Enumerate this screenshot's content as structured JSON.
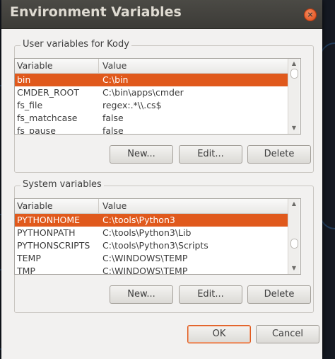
{
  "window": {
    "title": "Environment Variables",
    "close_symbol": "×"
  },
  "user_vars": {
    "group_label": "User variables for Kody",
    "header": {
      "variable": "Variable",
      "value": "Value"
    },
    "rows": [
      {
        "variable": "bin",
        "value": "C:\\bin",
        "selected": true
      },
      {
        "variable": "CMDER_ROOT",
        "value": "C:\\bin\\apps\\cmder",
        "selected": false
      },
      {
        "variable": "fs_file",
        "value": "regex:.*\\\\.cs$",
        "selected": false
      },
      {
        "variable": "fs_matchcase",
        "value": "false",
        "selected": false
      },
      {
        "variable": "fs_pause",
        "value": "false",
        "selected": false
      }
    ],
    "buttons": {
      "new": "New...",
      "edit": "Edit...",
      "delete": "Delete"
    }
  },
  "system_vars": {
    "group_label": "System variables",
    "header": {
      "variable": "Variable",
      "value": "Value"
    },
    "rows": [
      {
        "variable": "PYTHONHOME",
        "value": "C:\\tools\\Python3",
        "selected": true
      },
      {
        "variable": "PYTHONPATH",
        "value": "C:\\tools\\Python3\\Lib",
        "selected": false
      },
      {
        "variable": "PYTHONSCRIPTS",
        "value": "C:\\tools\\Python3\\Scripts",
        "selected": false
      },
      {
        "variable": "TEMP",
        "value": "C:\\WINDOWS\\TEMP",
        "selected": false
      },
      {
        "variable": "TMP",
        "value": "C:\\WINDOWS\\TEMP",
        "selected": false
      }
    ],
    "buttons": {
      "new": "New...",
      "edit": "Edit...",
      "delete": "Delete"
    }
  },
  "footer": {
    "ok": "OK",
    "cancel": "Cancel"
  },
  "colors": {
    "selection": "#e0591c",
    "titlebar": "#3c3b37",
    "dialog_bg": "#f2f1f0"
  },
  "icons": {
    "close": "close-icon",
    "scroll_up": "scroll-up-arrow-icon",
    "scroll_down": "scroll-down-arrow-icon"
  }
}
